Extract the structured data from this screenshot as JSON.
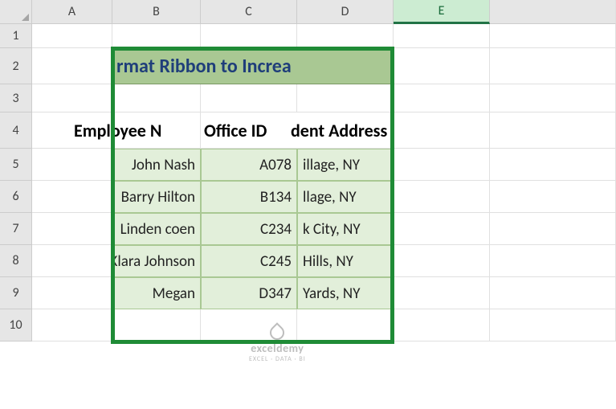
{
  "columns": [
    "A",
    "B",
    "C",
    "D",
    "E"
  ],
  "rows": [
    "1",
    "2",
    "3",
    "4",
    "5",
    "6",
    "7",
    "8",
    "9",
    "10"
  ],
  "selected_column": "E",
  "title": "rmat Ribbon to Increa",
  "headers": {
    "b": "Employee N",
    "c": "Office ID",
    "d_visible": "dent Address"
  },
  "table": [
    {
      "name": "John Nash",
      "id": "A078",
      "addr": "illage, NY"
    },
    {
      "name": "Barry Hilton",
      "id": "B134",
      "addr": "llage, NY"
    },
    {
      "name": "Linden coen",
      "id": "C234",
      "addr": "k City, NY"
    },
    {
      "name": "Klara Johnson",
      "id": "C245",
      "addr": " Hills, NY"
    },
    {
      "name": "Megan",
      "id": "D347",
      "addr": "Yards, NY"
    }
  ],
  "watermark": {
    "line1": "exceldemy",
    "line2": "EXCEL · DATA · BI"
  }
}
